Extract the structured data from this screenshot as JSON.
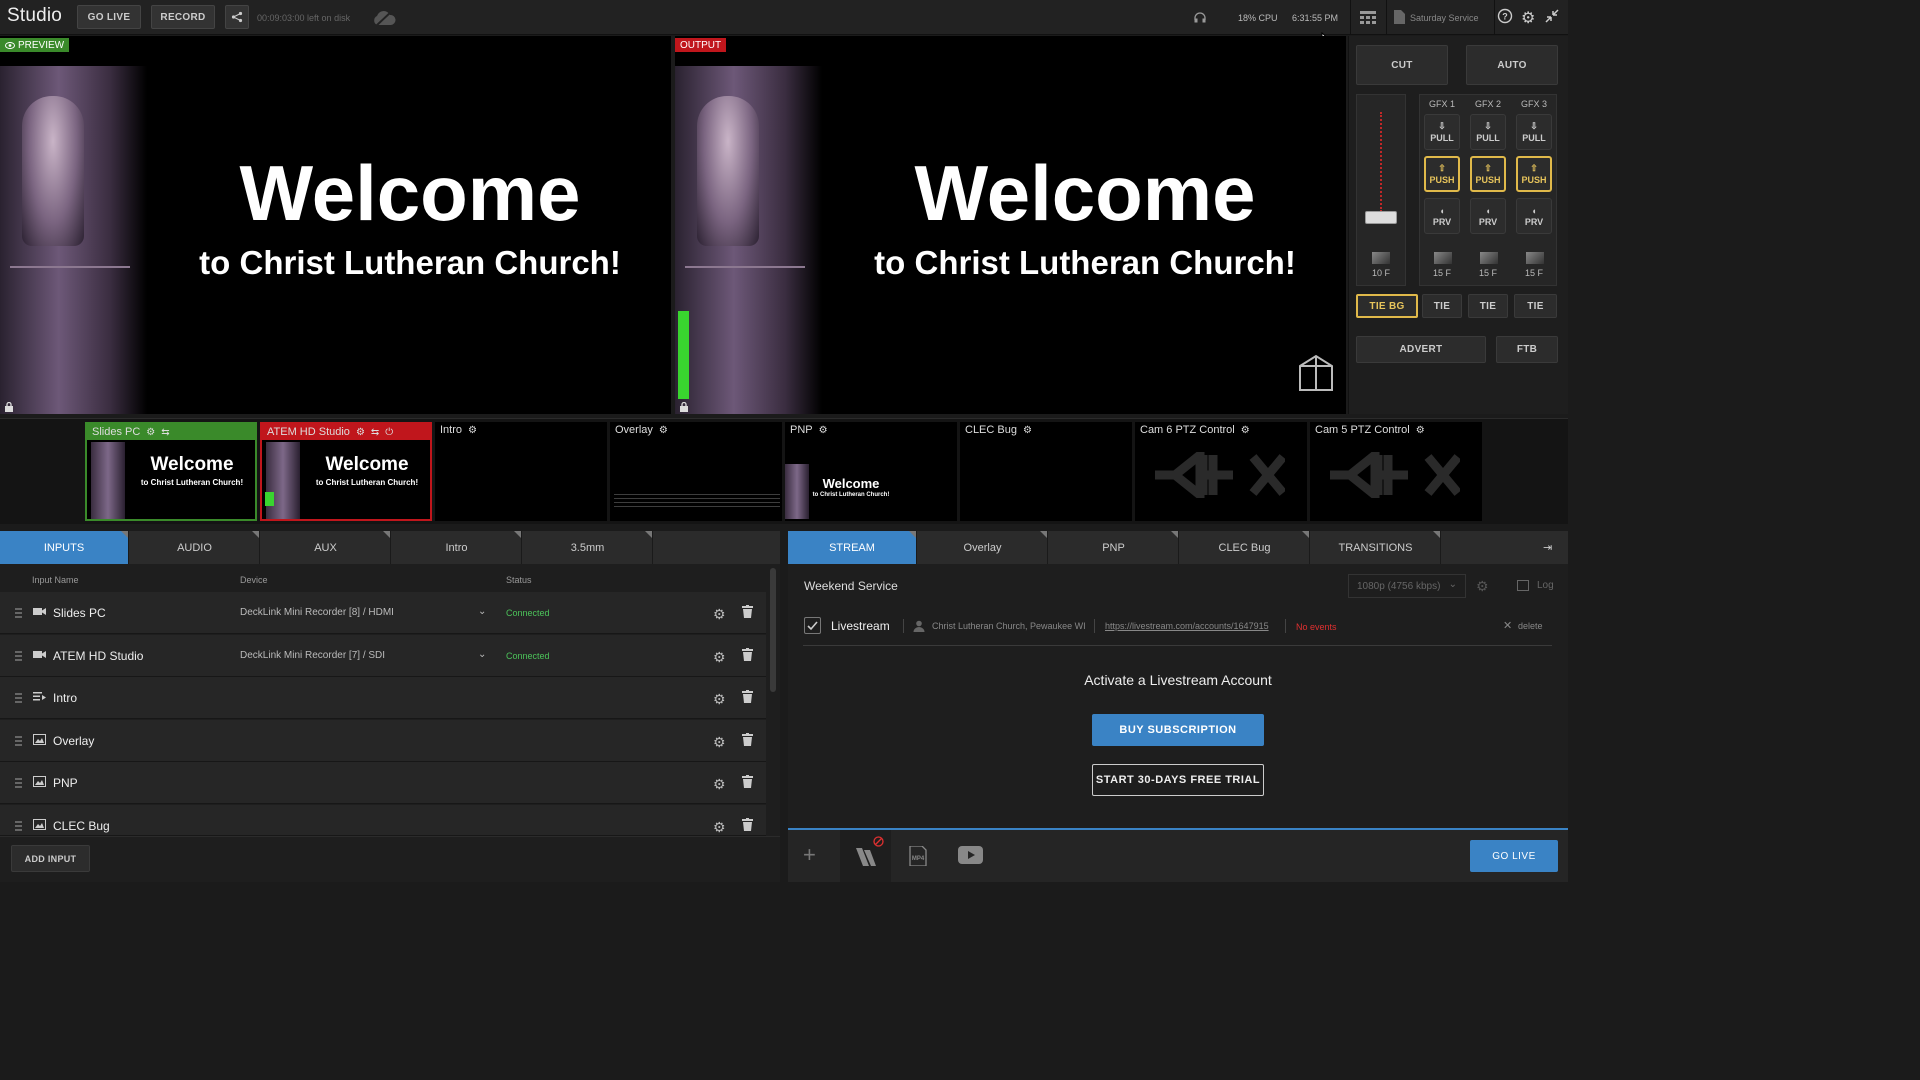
{
  "app": {
    "title": "Studio"
  },
  "topbar": {
    "go_live": "GO LIVE",
    "record": "RECORD",
    "disk_left": "00:09:03:00 left on disk",
    "cpu": "18% CPU",
    "clock": "6:31:55 PM",
    "project": "Saturday Service"
  },
  "preview": {
    "badge": "PREVIEW",
    "headline": "Welcome",
    "subline": "to Christ Lutheran Church!"
  },
  "output": {
    "badge": "OUTPUT",
    "headline": "Welcome",
    "subline": "to Christ Lutheran Church!"
  },
  "controls": {
    "cut": "CUT",
    "auto": "AUTO",
    "gfx": [
      {
        "label": "GFX 1",
        "pull": "PULL",
        "push": "PUSH",
        "prv": "PRV",
        "frames": "15 F"
      },
      {
        "label": "GFX 2",
        "pull": "PULL",
        "push": "PUSH",
        "prv": "PRV",
        "frames": "15 F"
      },
      {
        "label": "GFX 3",
        "pull": "PULL",
        "push": "PUSH",
        "prv": "PRV",
        "frames": "15 F"
      }
    ],
    "main_frames": "10 F",
    "tie_bg": "TIE BG",
    "tie": "TIE",
    "advert": "ADVERT",
    "ftb": "FTB"
  },
  "thumbnails": [
    {
      "name": "Slides PC",
      "headline": "Welcome",
      "subline": "to Christ Lutheran Church!"
    },
    {
      "name": "ATEM HD Studio",
      "headline": "Welcome",
      "subline": "to Christ Lutheran Church!"
    },
    {
      "name": "Intro"
    },
    {
      "name": "Overlay"
    },
    {
      "name": "PNP",
      "headline": "Welcome",
      "subline": "to Christ Lutheran Church!"
    },
    {
      "name": "CLEC Bug"
    },
    {
      "name": "Cam 6 PTZ Control"
    },
    {
      "name": "Cam 5 PTZ Control"
    }
  ],
  "left_tabs": [
    "INPUTS",
    "AUDIO",
    "AUX",
    "Intro",
    "3.5mm"
  ],
  "right_tabs": [
    "STREAM",
    "Overlay",
    "PNP",
    "CLEC Bug",
    "TRANSITIONS"
  ],
  "inputs_table": {
    "headers": {
      "name": "Input Name",
      "device": "Device",
      "status": "Status"
    },
    "rows": [
      {
        "name": "Slides PC",
        "device": "DeckLink Mini Recorder [8] / HDMI",
        "status": "Connected",
        "icon": "camera-icon"
      },
      {
        "name": "ATEM HD Studio",
        "device": "DeckLink Mini Recorder [7] / SDI",
        "status": "Connected",
        "icon": "camera-icon"
      },
      {
        "name": "Intro",
        "device": "",
        "status": "",
        "icon": "playlist-icon"
      },
      {
        "name": "Overlay",
        "device": "",
        "status": "",
        "icon": "image-icon"
      },
      {
        "name": "PNP",
        "device": "",
        "status": "",
        "icon": "image-icon"
      },
      {
        "name": "CLEC Bug",
        "device": "",
        "status": "",
        "icon": "image-icon"
      }
    ],
    "add_input": "ADD INPUT"
  },
  "stream": {
    "title": "Weekend Service",
    "quality": "1080p (4756 kbps)",
    "log": "Log",
    "provider": "Livestream",
    "account": "Christ Lutheran Church, Pewaukee WI",
    "url": "https://livestream.com/accounts/1647915",
    "events": "No events",
    "delete": "delete",
    "activate_title": "Activate a Livestream Account",
    "buy": "BUY SUBSCRIPTION",
    "trial": "START 30-DAYS FREE TRIAL",
    "go_live": "GO LIVE"
  },
  "colors": {
    "accent": "#3a83c5",
    "preview_green": "#3a8a2a",
    "output_red": "#c0161c",
    "gold": "#e0b94a",
    "connected": "#4cc35a"
  }
}
